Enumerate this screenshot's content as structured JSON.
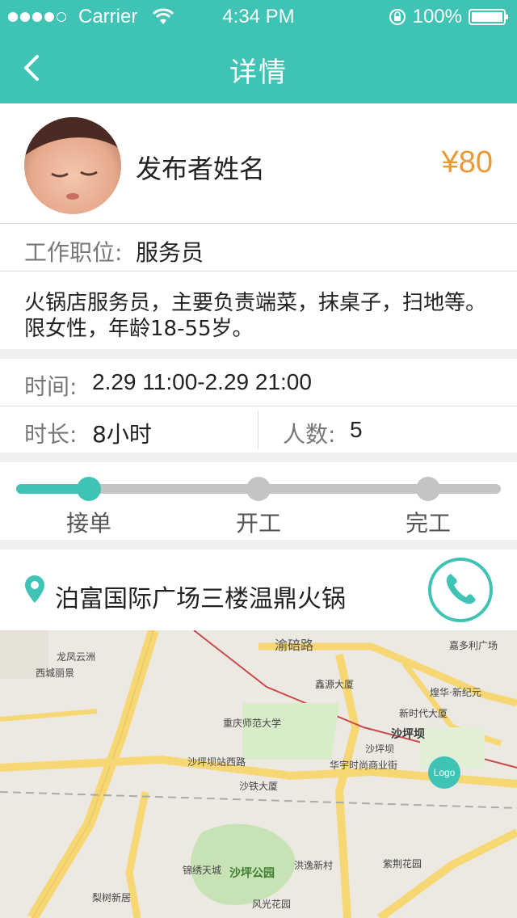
{
  "status_bar": {
    "carrier": "Carrier",
    "time": "4:34 PM",
    "battery": "100%"
  },
  "nav": {
    "title": "详情",
    "back_icon": "chevron-left-icon"
  },
  "publisher": {
    "name": "发布者姓名",
    "price": "¥80"
  },
  "job": {
    "position_label": "工作职位:",
    "position_value": "服务员",
    "description_line1": "火锅店服务员，主要负责端菜，抹桌子，扫地等。",
    "description_line2": "限女性，年龄18-55岁。"
  },
  "schedule": {
    "time_label": "时间:",
    "time_value": "2.29 11:00-2.29 21:00",
    "duration_label": "时长:",
    "duration_value": "8小时",
    "people_label": "人数:",
    "people_value": "5"
  },
  "progress": {
    "current_step": 1,
    "steps": [
      "接单",
      "开工",
      "完工"
    ]
  },
  "location": {
    "address": "泊富国际广场三楼温鼎火锅",
    "pin_icon": "location-pin-icon",
    "call_icon": "phone-icon"
  },
  "map": {
    "labels": {
      "longfeng": "龙凤云洲",
      "xicheng": "西城丽景",
      "yuqi_road": "渝碚路",
      "jiaduoli": "嘉多利广场",
      "xinyuan": "鑫源大厦",
      "huanghua": "煌华·新纪元",
      "xinshidai": "新时代大厦",
      "shida": "重庆师范大学",
      "shapingba_station": "沙坪坝",
      "shapingba": "沙坪坝",
      "huayu": "华宇时尚商业街",
      "station_road": "沙坪坝站西路",
      "shatie": "沙铁大厦",
      "park": "沙坪公园",
      "jinxiu": "锦绣天城",
      "hongyi": "洪逸新村",
      "zijing": "紫荆花园",
      "lizi": "梨树新居",
      "fengguang": "风光花园",
      "logo": "Logo"
    },
    "accent": "#3fc3b5",
    "road_yellow": "#f7d774"
  },
  "colors": {
    "teal": "#3fc3b5",
    "price_orange": "#e89a36"
  }
}
